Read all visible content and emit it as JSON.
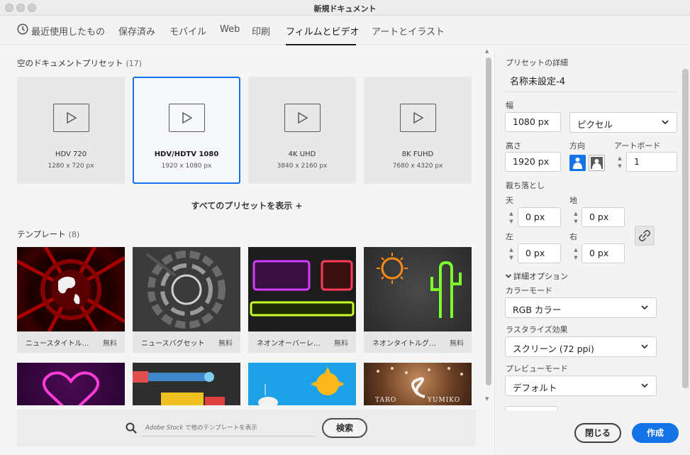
{
  "window": {
    "title": "新規ドキュメント"
  },
  "tabs": [
    {
      "label": "最近使用したもの"
    },
    {
      "label": "保存済み"
    },
    {
      "label": "モバイル"
    },
    {
      "label": "Web"
    },
    {
      "label": "印刷"
    },
    {
      "label": "フィルムとビデオ",
      "active": true
    },
    {
      "label": "アートとイラスト"
    }
  ],
  "presets_section": {
    "title": "空のドキュメントプリセット",
    "count": "(17)"
  },
  "presets": [
    {
      "name": "HDV 720",
      "size": "1280 x 720 px"
    },
    {
      "name": "HDV/HDTV 1080",
      "size": "1920 x 1080 px",
      "selected": true
    },
    {
      "name": "4K UHD",
      "size": "3840 x 2160 px"
    },
    {
      "name": "8K FUHD",
      "size": "7680 x 4320 px"
    }
  ],
  "all_presets_link": "すべてのプリセットを表示 +",
  "templates_section": {
    "title": "テンプレート",
    "count": "(8)"
  },
  "templates": [
    {
      "name": "ニュースタイトル…",
      "price": "無料"
    },
    {
      "name": "ニュースバグセット",
      "price": "無料"
    },
    {
      "name": "ネオンオーバーレ…",
      "price": "無料"
    },
    {
      "name": "ネオンタイトルグ…",
      "price": "無料"
    }
  ],
  "template_row2_image_text": {
    "wedding_left": "TARO",
    "wedding_right": "YUMIKO"
  },
  "search": {
    "prefix": "Adobe Stock",
    "placeholder_rest": " で他のテンプレートを表示",
    "button": "検索"
  },
  "details": {
    "header": "プリセットの詳細",
    "name": "名称未設定-4",
    "width_label": "幅",
    "width": "1080 px",
    "unit": "ピクセル",
    "height_label": "高さ",
    "height": "1920 px",
    "orientation_label": "方向",
    "orientation": "portrait",
    "artboard_label": "アートボード",
    "artboard": "1",
    "bleed_label": "裁ち落とし",
    "bleed": {
      "top_label": "天",
      "top": "0 px",
      "bottom_label": "地",
      "bottom": "0 px",
      "left_label": "左",
      "left": "0 px",
      "right_label": "右",
      "right": "0 px"
    },
    "advanced_label": "詳細オプション",
    "color_mode_label": "カラーモード",
    "color_mode": "RGB カラー",
    "raster_label": "ラスタライズ効果",
    "raster": "スクリーン (72 ppi)",
    "preview_label": "プレビューモード",
    "preview": "デフォルト"
  },
  "buttons": {
    "close": "閉じる",
    "create": "作成"
  },
  "colors": {
    "accent": "#1473e6",
    "panel": "#f5f5f5"
  }
}
